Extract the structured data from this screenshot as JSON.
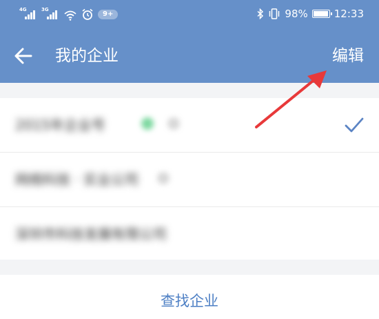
{
  "status_bar": {
    "signal_1_label": "4G",
    "signal_2_label": "3G",
    "notification_badge": "9+",
    "battery_percent_text": "98%",
    "battery_level": 0.98,
    "time": "12:33"
  },
  "app_bar": {
    "title": "我的企业",
    "edit_label": "编辑",
    "background_color": "#6690c9"
  },
  "companies": [
    {
      "name": "2015年企业号",
      "selected": true
    },
    {
      "name": "网络科技 · 实业公司",
      "selected": false
    },
    {
      "name": "深圳市科技发展有限公司",
      "selected": false
    }
  ],
  "footer": {
    "find_company_label": "查找企业",
    "link_color": "#4d7fc4"
  },
  "annotation": {
    "arrow_color": "#e8393a",
    "points_to": "edit-button"
  },
  "icons": {
    "back": "back-arrow-icon",
    "check": "checkmark-icon",
    "wifi": "wifi-icon",
    "alarm": "alarm-clock-icon",
    "bluetooth": "bluetooth-icon",
    "vibrate": "vibrate-icon",
    "battery": "battery-icon"
  }
}
